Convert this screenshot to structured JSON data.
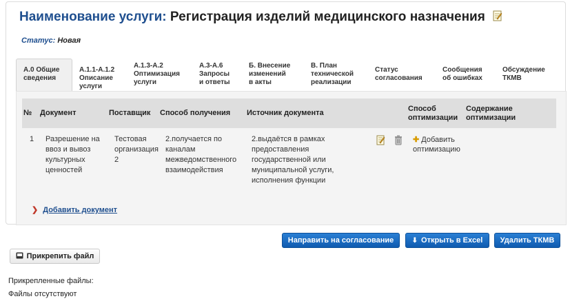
{
  "header": {
    "title_label": "Наименование услуги:",
    "title_value": "Регистрация изделий медицинского назначения"
  },
  "status": {
    "label": "Статус:",
    "value": "Новая"
  },
  "tabs": [
    {
      "label": "А.0 Общие\nсведения",
      "active": true
    },
    {
      "label": "А.1.1-А.1.2\nОписание\nуслуги",
      "active": false
    },
    {
      "label": "А.1.3-А.2\nОптимизация\nуслуги",
      "active": false
    },
    {
      "label": "А.3-А.6\nЗапросы\nи ответы",
      "active": false
    },
    {
      "label": "Б. Внесение\nизменений\nв акты",
      "active": false
    },
    {
      "label": "В. План\nтехнической\nреализации",
      "active": false
    },
    {
      "label": "Статус\nсогласования",
      "active": false
    },
    {
      "label": "Сообщения\nоб ошибках",
      "active": false
    },
    {
      "label": "Обсуждение\nТКМВ",
      "active": false
    }
  ],
  "table": {
    "columns": [
      "№",
      "Документ",
      "Поставщик",
      "Способ получения",
      "Источник документа",
      "Способ\nоптимизации",
      "Содержание\nоптимизации"
    ],
    "rows": [
      {
        "num": "1",
        "document": "Разрешение на\nввоз и вывоз\nкультурных\nценностей",
        "supplier": "Тестовая\nорганизация\n2",
        "method": "2.получается по\nканалам\nмежведомственного\nвзаимодействия",
        "source": "2.выдаётся в рамках\nпредоставления\nгосударственной или\nмуниципальной услуги,\nисполнения функции",
        "add_optimization": "Добавить\nоптимизацию"
      }
    ]
  },
  "add_document_label": "Добавить документ",
  "buttons": {
    "send_approval": "Направить на согласование",
    "open_excel": "Открыть в Excel",
    "delete_tkmv": "Удалить ТКМВ",
    "attach_file": "Прикрепить файл"
  },
  "files": {
    "label": "Прикрепленные файлы:",
    "empty": "Файлы отсутствуют"
  },
  "colors": {
    "accent": "#1f4f8f",
    "button_blue": "#1565c0"
  }
}
